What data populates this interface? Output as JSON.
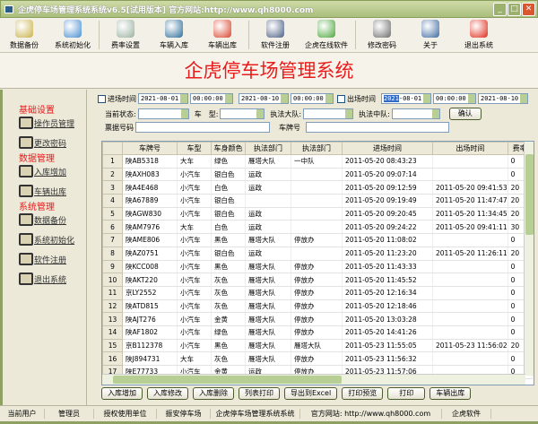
{
  "window": {
    "title": "企虎停车场管理系统系统v6.5[试用版本] 官方网站:http://www.qh8000.com"
  },
  "toolbar": [
    {
      "label": "数据备份",
      "icon": "database-backup-icon",
      "color": "#c9b24a"
    },
    {
      "label": "系统初始化",
      "icon": "init-icon",
      "color": "#4a8fd0"
    },
    {
      "label": "费率设置",
      "icon": "magnifier-icon",
      "color": "#9ab0a0"
    },
    {
      "label": "车辆入库",
      "icon": "database-in-icon",
      "color": "#2d6e9a"
    },
    {
      "label": "车辆出库",
      "icon": "check-ball-icon",
      "color": "#d9452e"
    },
    {
      "label": "软件注册",
      "icon": "register-icon",
      "color": "#4b5e84"
    },
    {
      "label": "企虎在线软件",
      "icon": "refresh-icon",
      "color": "#4ca63a"
    },
    {
      "label": "修改密码",
      "icon": "key-icon",
      "color": "#6d6d6d"
    },
    {
      "label": "关于",
      "icon": "about-icon",
      "color": "#3e6aa0"
    },
    {
      "label": "退出系统",
      "icon": "exit-icon",
      "color": "#e02a1a"
    }
  ],
  "banner": {
    "title": "企虎停车场管理系统"
  },
  "sidebar": {
    "sections": [
      {
        "title": "基础设置",
        "items": [
          "操作员管理",
          "更改密码"
        ]
      },
      {
        "title": "数据管理",
        "items": [
          "入库增加",
          "车辆出库"
        ]
      },
      {
        "title": "系统管理",
        "items": [
          "数据备份",
          "系统初始化",
          "软件注册",
          "退出系统"
        ]
      }
    ]
  },
  "filters": {
    "entry_label": "进场时间",
    "entry_from_date": "2021-08-01",
    "entry_from_time": "00:00:00",
    "entry_to_date": "2021-08-10",
    "entry_to_time": "00:00:00",
    "exit_label": "出场时间",
    "exit_from_year": "2021",
    "exit_from_rest": "-08-01",
    "exit_from_time": "00:00:00",
    "exit_to_date": "2021-08-10",
    "status_label": "当前状态:",
    "type_label": "车　型:",
    "brigade_label": "执法大队:",
    "squad_label": "执法中队:",
    "confirm": "确认",
    "ticket_label": "票据号码",
    "plate_label": "车牌号"
  },
  "table": {
    "columns": [
      "车牌号",
      "车型",
      "车身颜色",
      "执法部门",
      "执法部门",
      "进场时间",
      "出场时间",
      "费率"
    ],
    "rows": [
      [
        "1",
        "陕AB5318",
        "大车",
        "绿色",
        "雁塔大队",
        "一中队",
        "2011-05-20 08:43:23",
        "",
        "0"
      ],
      [
        "2",
        "陕AXH083",
        "小汽车",
        "银白色",
        "运政",
        "",
        "2011-05-20 09:07:14",
        "",
        "0"
      ],
      [
        "3",
        "陕A4E468",
        "小汽车",
        "白色",
        "运政",
        "",
        "2011-05-20 09:12:59",
        "2011-05-20 09:41:53",
        "20"
      ],
      [
        "4",
        "陕A67889",
        "小汽车",
        "银白色",
        "",
        "",
        "2011-05-20 09:19:49",
        "2011-05-20 11:47:47",
        "20"
      ],
      [
        "5",
        "陕AGW830",
        "小汽车",
        "银白色",
        "运政",
        "",
        "2011-05-20 09:20:45",
        "2011-05-20 11:34:45",
        "20"
      ],
      [
        "6",
        "陕AM7976",
        "大车",
        "白色",
        "运政",
        "",
        "2011-05-20 09:24:22",
        "2011-05-20 09:41:11",
        "30"
      ],
      [
        "7",
        "陕AME806",
        "小汽车",
        "黑色",
        "雁塔大队",
        "停放办",
        "2011-05-20 11:08:02",
        "",
        "0"
      ],
      [
        "8",
        "陕AZ0751",
        "小汽车",
        "银白色",
        "运政",
        "",
        "2011-05-20 11:23:20",
        "2011-05-20 11:26:11",
        "20"
      ],
      [
        "9",
        "陕KCC008",
        "小汽车",
        "黑色",
        "雁塔大队",
        "停放办",
        "2011-05-20 11:43:33",
        "",
        "0"
      ],
      [
        "10",
        "陕AKT220",
        "小汽车",
        "灰色",
        "雁塔大队",
        "停放办",
        "2011-05-20 11:45:52",
        "",
        "0"
      ],
      [
        "11",
        "京LY2552",
        "小汽车",
        "灰色",
        "雁塔大队",
        "停放办",
        "2011-05-20 12:16:34",
        "",
        "0"
      ],
      [
        "12",
        "陕ATD815",
        "小汽车",
        "灰色",
        "雁塔大队",
        "停放办",
        "2011-05-20 12:18:46",
        "",
        "0"
      ],
      [
        "13",
        "陕AJT276",
        "小汽车",
        "金黄",
        "雁塔大队",
        "停放办",
        "2011-05-20 13:03:28",
        "",
        "0"
      ],
      [
        "14",
        "陕AF1802",
        "小汽车",
        "绿色",
        "雁塔大队",
        "停放办",
        "2011-05-20 14:41:26",
        "",
        "0"
      ],
      [
        "15",
        "京B112378",
        "小汽车",
        "黑色",
        "雁塔大队",
        "雁塔大队",
        "2011-05-23 11:55:05",
        "2011-05-23 11:56:02",
        "20"
      ],
      [
        "16",
        "陕J894731",
        "大车",
        "灰色",
        "雁塔大队",
        "停放办",
        "2011-05-23 11:56:32",
        "",
        "0"
      ],
      [
        "17",
        "陕E77733",
        "小汽车",
        "金黄",
        "运政",
        "停放办",
        "2011-05-23 11:57:06",
        "",
        "0"
      ]
    ]
  },
  "buttons": [
    "入库增加",
    "入库修改",
    "入库删除",
    "列表打印",
    "导出到Excel",
    "打印预览",
    "打印",
    "车辆出库"
  ],
  "status": [
    "当前用户",
    "管理员",
    "授权使用单位",
    "振安停车场",
    "企虎停车场管理系统系统",
    "官方网站: http://www.qh8000.com",
    "企虎软件"
  ]
}
